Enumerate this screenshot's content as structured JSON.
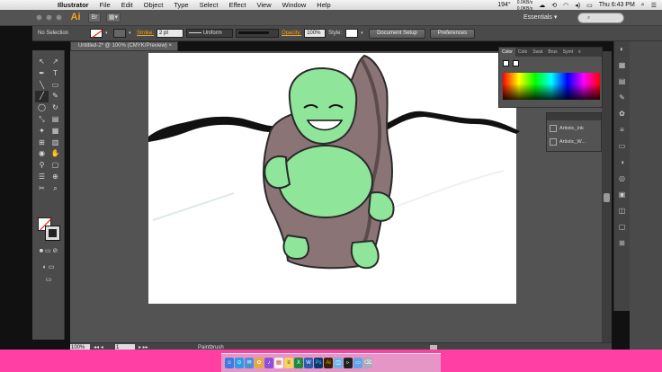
{
  "menubar": {
    "app_name": "Illustrator",
    "items": [
      "File",
      "Edit",
      "Object",
      "Type",
      "Select",
      "Effect",
      "View",
      "Window",
      "Help"
    ],
    "net_up": "0.0KB/s",
    "net_down": "0.0KB/s",
    "clock": "Thu 6:43 PM",
    "temp": "194°"
  },
  "appbar": {
    "logo": "Ai",
    "workspace": "Essentials",
    "search_placeholder": ""
  },
  "control_bar": {
    "selection": "No Selection",
    "stroke_label": "Stroke:",
    "stroke_value": "2 pt",
    "profile": "Uniform",
    "opacity_label": "Opacity:",
    "opacity_value": "100%",
    "style_label": "Style:",
    "doc_setup": "Document Setup",
    "preferences": "Preferences"
  },
  "document": {
    "tab_title": "Untitled-2* @ 100% (CMYK/Preview)"
  },
  "status": {
    "zoom": "100%",
    "page": "1",
    "tool_name": "Paintbrush"
  },
  "color_panel": {
    "tabs": [
      "Color",
      "Colo",
      "Swat",
      "Brus",
      "Symt"
    ],
    "active_tab": "Color"
  },
  "brushes_panel": {
    "items": [
      "Artistic_Ink",
      "Artistic_W..."
    ]
  },
  "toolbar": {
    "tools": [
      "↖",
      "↗",
      "✒",
      "T",
      "╲",
      "▭",
      "╱",
      "✎",
      "◯",
      "↻",
      "⤡",
      "▤",
      "✦",
      "▦",
      "⊞",
      "▥",
      "◉",
      "✋",
      "⚲",
      "▢",
      "☰",
      "⊕",
      "✂",
      "⌕"
    ]
  },
  "colors": {
    "accent": "#f7a21b",
    "bottom_bg": "#ff3fa3",
    "buddha_skin": "#8fe59a",
    "buddha_robe": "#8b7476"
  },
  "dock_icons": [
    "finder-icon",
    "safari-icon",
    "mail-icon",
    "photos-icon",
    "itunes-icon",
    "calendar-icon",
    "notes-icon",
    "excel-icon",
    "word-icon",
    "photoshop-icon",
    "illustrator-icon",
    "preview-icon",
    "terminal-icon",
    "folder-icon",
    "trash-icon"
  ]
}
